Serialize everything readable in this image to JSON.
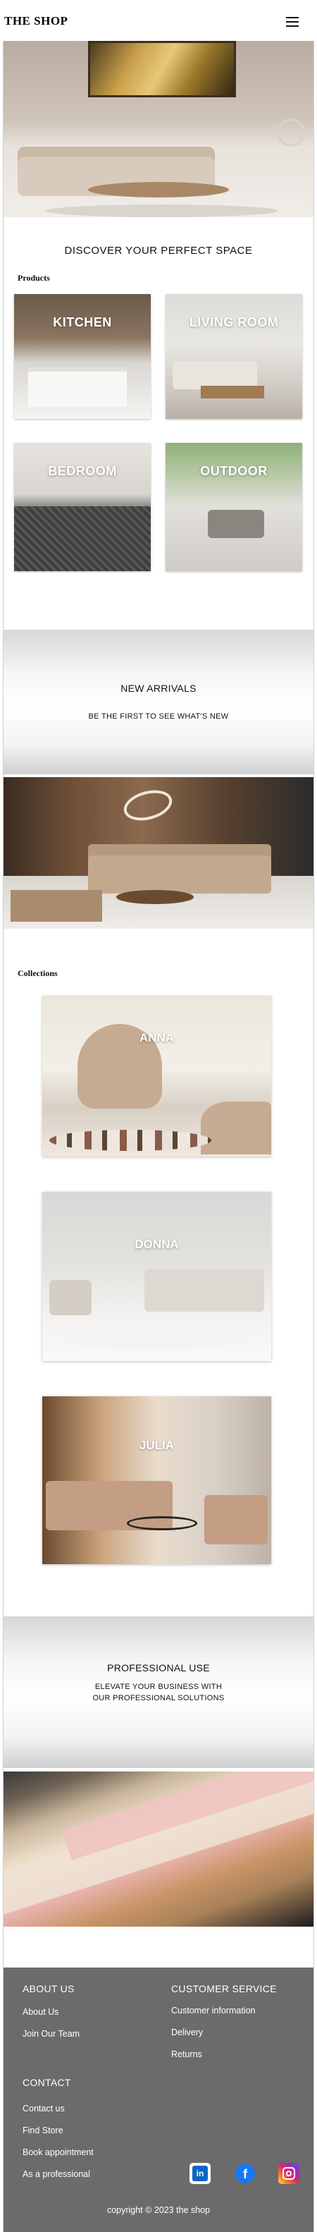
{
  "header": {
    "logo": "THE SHOP",
    "menu_icon": "hamburger-menu-icon"
  },
  "discover": {
    "title": "DISCOVER YOUR PERFECT SPACE"
  },
  "products": {
    "heading": "Products",
    "categories": [
      {
        "label": "KITCHEN"
      },
      {
        "label": "LIVING ROOM"
      },
      {
        "label": "BEDROOM"
      },
      {
        "label": "OUTDOOR"
      }
    ]
  },
  "arrivals": {
    "title": "NEW ARRIVALS",
    "subtitle": "BE THE FIRST TO SEE WHAT'S NEW"
  },
  "collections": {
    "heading": "Collections",
    "items": [
      {
        "label": "ANNA"
      },
      {
        "label": "DONNA"
      },
      {
        "label": "JULIA"
      }
    ]
  },
  "professional": {
    "title": "PROFESSIONAL USE",
    "subtitle_line1": "ELEVATE YOUR BUSINESS WITH",
    "subtitle_line2": "OUR PROFESSIONAL SOLUTIONS"
  },
  "footer": {
    "about": {
      "heading": "ABOUT US",
      "links": [
        "About Us",
        "Join Our Team"
      ]
    },
    "customer_service": {
      "heading": "CUSTOMER SERVICE",
      "links": [
        "Customer information",
        "Delivery",
        "Returns"
      ]
    },
    "contact": {
      "heading": "CONTACT",
      "links": [
        "Contact us",
        "Find Store",
        "Book appointment",
        "As a professional"
      ]
    },
    "social": [
      {
        "icon": "linkedin-icon",
        "color": "#0a66c2"
      },
      {
        "icon": "facebook-icon",
        "color": "#1877f2"
      },
      {
        "icon": "instagram-icon",
        "color": "#d6249f"
      }
    ],
    "copyright": "copyright © 2023 the shop"
  },
  "colors": {
    "footer_bg": "#6b6b6b",
    "text": "#111111",
    "white": "#ffffff"
  }
}
